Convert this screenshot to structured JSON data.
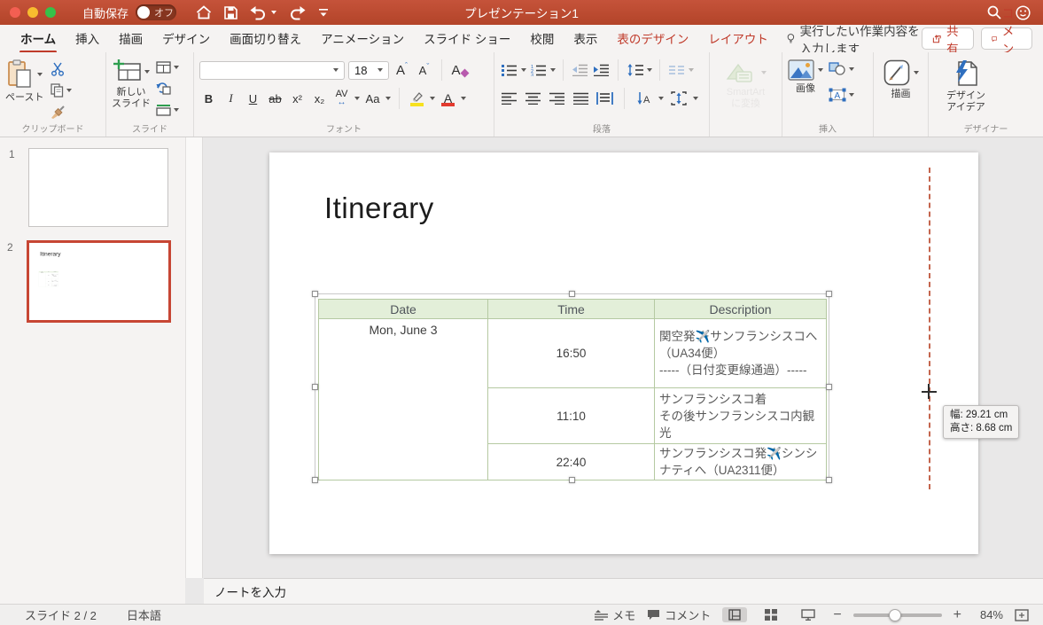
{
  "titlebar": {
    "title": "プレゼンテーション1",
    "autosave_label": "自動保存",
    "autosave_state": "オフ"
  },
  "tabbar": {
    "tabs": [
      {
        "label": "ホーム"
      },
      {
        "label": "挿入"
      },
      {
        "label": "描画"
      },
      {
        "label": "デザイン"
      },
      {
        "label": "画面切り替え"
      },
      {
        "label": "アニメーション"
      },
      {
        "label": "スライド ショー"
      },
      {
        "label": "校閲"
      },
      {
        "label": "表示"
      },
      {
        "label": "表のデザイン"
      },
      {
        "label": "レイアウト"
      }
    ],
    "tell_me": "実行したい作業内容を入力します",
    "share_label": "共有",
    "comment_label": "コメント"
  },
  "ribbon": {
    "paste_label": "ペースト",
    "new_slide_label": "新しい\nスライド",
    "font_size": "18",
    "bold": "B",
    "italic": "I",
    "underline": "U",
    "strike": "ab",
    "superscript": "x²",
    "subscript": "x₂",
    "spacing": "AV",
    "case": "Aa",
    "grow_font": "A",
    "shrink_font": "A",
    "clear_format": "A",
    "font_color": "A",
    "smartart_label": "SmartArt\nに変換",
    "picture_label": "画像",
    "draw_label": "描画",
    "design_ideas_label": "デザイン\nアイデア",
    "groups": {
      "clipboard": "クリップボード",
      "slides": "スライド",
      "font": "フォント",
      "paragraph": "段落",
      "insert": "挿入",
      "designer": "デザイナー"
    }
  },
  "sidebar": {
    "slides": [
      {
        "number": "1"
      },
      {
        "number": "2"
      }
    ]
  },
  "slide": {
    "title": "Itinerary"
  },
  "table": {
    "headers": [
      "Date",
      "Time",
      "Description"
    ],
    "date": "Mon, June 3",
    "rows": [
      {
        "time": "16:50",
        "desc": "関空発✈️サンフランシスコへ（UA34便）\n-----（日付変更線通過）-----"
      },
      {
        "time": "11:10",
        "desc": "サンフランシスコ着\nその後サンフランシスコ内観光"
      },
      {
        "time": "22:40",
        "desc": "サンフランシスコ発✈️シンシナティへ（UA2311便）"
      }
    ]
  },
  "tooltip": {
    "width": "幅: 29.21 cm",
    "height": "高さ: 8.68 cm"
  },
  "notes": {
    "placeholder": "ノートを入力"
  },
  "statusbar": {
    "slide_info": "スライド 2 / 2",
    "language": "日本語",
    "memo_label": "メモ",
    "comment_label": "コメント",
    "zoom_level": "84%"
  },
  "colors": {
    "titlebar_red": "#BC4A31",
    "accent_red": "#C03B2B",
    "table_header_green": "#E3EFD9",
    "table_border_green": "#B5C9A2",
    "ribbon_blue": "#2F6FBF",
    "selection_orange": "#C74634"
  }
}
